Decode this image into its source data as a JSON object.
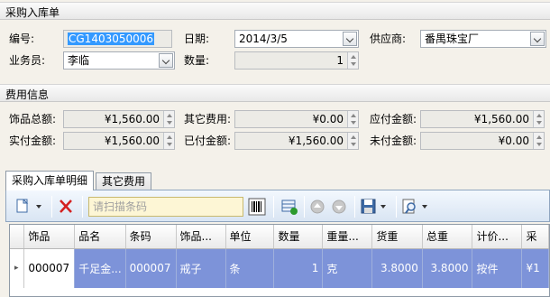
{
  "purchase": {
    "section_title": "采购入库单",
    "number_label": "编号:",
    "number_value": "CG1403050006",
    "date_label": "日期:",
    "date_value": "2014/3/5",
    "supplier_label": "供应商:",
    "supplier_value": "番禺珠宝厂",
    "salesman_label": "业务员:",
    "salesman_value": "李临",
    "qty_label": "数量:",
    "qty_value": "1"
  },
  "fees": {
    "section_title": "费用信息",
    "goods_total_label": "饰品总额:",
    "goods_total_value": "¥1,560.00",
    "other_fee_label": "其它费用:",
    "other_fee_value": "¥0.00",
    "payable_label": "应付金额:",
    "payable_value": "¥1,560.00",
    "actual_label": "实付金额:",
    "actual_value": "¥1,560.00",
    "paid_label": "已付金额:",
    "paid_value": "¥1,560.00",
    "unpaid_label": "未付金额:",
    "unpaid_value": "¥0.00"
  },
  "tabs": [
    {
      "label": "采购入库单明细",
      "active": true
    },
    {
      "label": "其它费用",
      "active": false
    }
  ],
  "toolbar": {
    "scan_placeholder": "请扫描条码"
  },
  "grid": {
    "columns": [
      "饰品",
      "品名",
      "条码",
      "饰品...",
      "单位",
      "数量",
      "重量...",
      "货重",
      "总重",
      "计价...",
      "采"
    ],
    "rows": [
      [
        "000007",
        "千足金...",
        "000007",
        "戒子",
        "条",
        "1",
        "克",
        "3.8000",
        "3.8000",
        "按件",
        "¥1"
      ]
    ]
  },
  "colors": {
    "selected_row": "#7d93d9",
    "toolbar_bg": "#d9e5f3",
    "scan_bg": "#fdf6d5"
  }
}
